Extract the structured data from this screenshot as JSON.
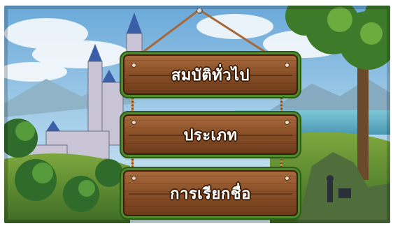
{
  "menu": {
    "items": [
      {
        "label": "สมบัติทั่วไป"
      },
      {
        "label": "ประเภท"
      },
      {
        "label": "การเรียกชื่อ"
      }
    ]
  },
  "colors": {
    "sky": "#7db7de",
    "wood": "#8a5128",
    "moss": "#4c8a2c",
    "label": "#ffffff"
  },
  "icons": [
    "rope",
    "hook",
    "bolt"
  ]
}
